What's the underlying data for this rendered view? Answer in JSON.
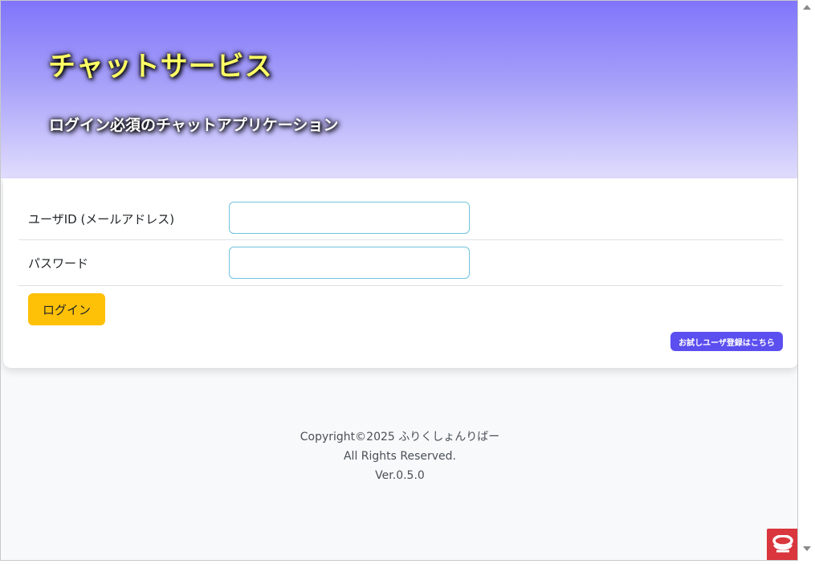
{
  "header": {
    "title": "チャットサービス",
    "subtitle": "ログイン必須のチャットアプリケーション"
  },
  "form": {
    "userid_label": "ユーザID (メールアドレス)",
    "userid_value": "",
    "password_label": "パスワード",
    "password_value": "",
    "login_label": "ログイン",
    "trial_label": "お試しユーザ登録はこちら"
  },
  "footer": {
    "copyright": "Copyright©2025 ふりくしょんりばー",
    "rights": "All Rights Reserved.",
    "version": "Ver.0.5.0"
  },
  "colors": {
    "accent": "#5b4ff0",
    "login_button": "#ffc107",
    "title": "#ffff66",
    "input_border": "#6fc3dc"
  },
  "icons": {
    "corner_logo": "cloud-badge-icon"
  }
}
